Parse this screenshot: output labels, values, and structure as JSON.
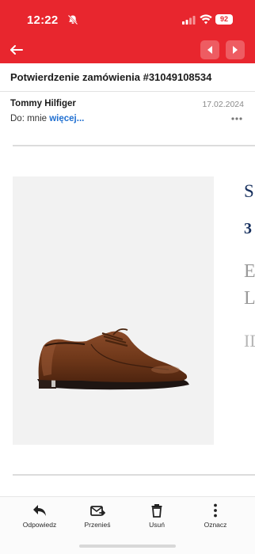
{
  "status_bar": {
    "time": "12:22",
    "battery": "92"
  },
  "email": {
    "subject": "Potwierdzenie zamówienia #31049108534",
    "sender": "Tommy Hilfiger",
    "date": "17.02.2024",
    "recipient_prefix": "Do: mnie",
    "recipient_more": "więcej..."
  },
  "product": {
    "cut_text_1": "S",
    "cut_text_2": "3",
    "cut_text_3": "E",
    "cut_text_4": "L",
    "cut_text_5": "ID"
  },
  "toolbar": {
    "reply_label": "Odpowiedz",
    "move_label": "Przenieś",
    "delete_label": "Usuń",
    "mark_label": "Oznacz"
  },
  "colors": {
    "header_red": "#e8262e",
    "link_blue": "#1f6fd1",
    "brand_navy": "#17305e"
  }
}
